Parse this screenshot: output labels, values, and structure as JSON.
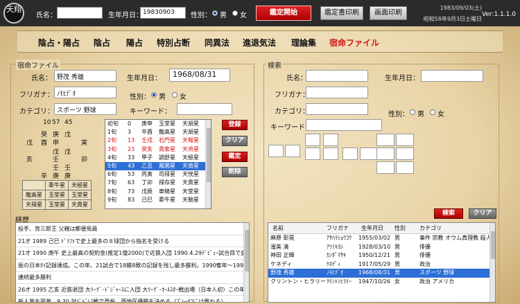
{
  "topbar": {
    "logo_text": "天翔",
    "name_label": "氏名：",
    "name_value": "",
    "birth_label": "生年月日：",
    "birth_value": "19830903",
    "sex_label": "性別：",
    "sex_male": "男",
    "sex_female": "女",
    "btn_appraise": "鑑定開始",
    "btn_print_report": "鑑定書印刷",
    "btn_print_screen": "画面印刷",
    "date_line1": "1983/09/03(土)",
    "date_line2": "昭和58年9月3日土曜日",
    "version": "Ver:1.1.1.0"
  },
  "menu": {
    "items": [
      "陰占・陽占",
      "陰占",
      "陽占",
      "特別占断",
      "同異法",
      "進退気法",
      "理論集",
      "宿命ファイル"
    ],
    "active_index": 7,
    "active_color": "#d01818"
  },
  "file_panel": {
    "title": "宿命ファイル",
    "name_label": "氏名：",
    "name_value": "野茂 秀雄",
    "furigana_label": "フリガナ：",
    "furigana_value": "ﾉﾓﾋﾃﾞｵ",
    "category_label": "カテゴリ：",
    "category_value": "スポーツ 野球",
    "birth_label": "生年月日：",
    "birth_value": "1968/08/31",
    "sex_label": "性別：",
    "sex_male": "男",
    "sex_female": "女",
    "keyword_label": "キーワード：",
    "keyword_value": ""
  },
  "pillars": {
    "nums": [
      "10",
      "57",
      "45"
    ],
    "stems": [
      "癸",
      "庚",
      "戊"
    ],
    "branches": [
      "戊",
      "酉",
      "申",
      "寅"
    ],
    "hidden": [
      "戊",
      "戊"
    ],
    "extra": [
      "亥",
      "壬",
      "卯"
    ],
    "row4": [
      "壬",
      "壬"
    ],
    "row5": [
      "辛",
      "庚",
      "庚"
    ]
  },
  "star_table": [
    [
      "",
      "牽牛星",
      "天極星"
    ],
    [
      "龍高星",
      "玉堂星",
      "玉堂星"
    ],
    [
      "天禄星",
      "玉堂星",
      "天貴星"
    ]
  ],
  "luck_list": [
    {
      "period": "初旬",
      "age": "0",
      "kan": "庚申",
      "star": "玉堂星",
      "star2": "天胡星",
      "red": false,
      "selected": false
    },
    {
      "period": "1旬",
      "age": "3",
      "kan": "辛酉",
      "star": "龍高星",
      "star2": "天胡星",
      "red": false,
      "selected": false
    },
    {
      "period": "2旬",
      "age": "13",
      "kan": "壬戌",
      "star": "石門星",
      "star2": "天報星",
      "red": true,
      "selected": false
    },
    {
      "period": "3旬",
      "age": "23",
      "kan": "癸亥",
      "star": "貴索星",
      "star2": "天将星",
      "red": true,
      "selected": false
    },
    {
      "period": "4旬",
      "age": "33",
      "kan": "甲子",
      "star": "調舒星",
      "star2": "天極星",
      "red": false,
      "selected": false
    },
    {
      "period": "5旬",
      "age": "43",
      "kan": "乙丑",
      "star": "鳳閣星",
      "star2": "天南星",
      "red": false,
      "selected": true
    },
    {
      "period": "6旬",
      "age": "53",
      "kan": "丙寅",
      "star": "司禄星",
      "star2": "天恍星",
      "red": false,
      "selected": false
    },
    {
      "period": "7旬",
      "age": "63",
      "kan": "丁卯",
      "star": "禄存星",
      "star2": "天貴星",
      "red": false,
      "selected": false
    },
    {
      "period": "8旬",
      "age": "73",
      "kan": "戊辰",
      "star": "車騎星",
      "star2": "天堂星",
      "red": false,
      "selected": false
    },
    {
      "period": "9旬",
      "age": "83",
      "kan": "己巳",
      "star": "牽牛星",
      "star2": "天馳星",
      "red": false,
      "selected": false
    }
  ],
  "side_buttons": {
    "register": "登録",
    "clear": "クリア",
    "appraise": "鑑定",
    "delete": "削除"
  },
  "memo": {
    "title": "経歴",
    "lines": [
      "投手、背三郎王 父親は郵便局員",
      "21才 1989 己巳 ﾄﾞﾗﾌﾄで史上最多の８球団から指名を受ける",
      "21才 1990 庚午 史上最高の契約金(推定1億2000)で近鉄入団 1990.4.29ﾃﾞﾋﾞｭｰ試合目で史上2人目の17奪三",
      "振の日本ﾀｲ記録達成。この年、21試合で18勝8敗の記録を残し最多勝利。1990奪年〜1993奪貢まで4年",
      "連続最多勝利",
      "26才 1995 乙亥 近鉄退団 大ﾘｰｸﾞ･ﾄﾞｼﾞｬｰｽに入団 大ﾘｰｸﾞ･ｵｰﾙｽﾀｰ戦出場（日本人初）この年１３勝６敗で",
      "新人賞を受賞。9.30 対ﾊﾟﾄﾞﾚｽ戦で登板、西地区優勝を決める（ﾌﾟﾚｰｵﾌには敗れる）"
    ]
  },
  "search_panel": {
    "title": "検索",
    "name_label": "氏名：",
    "birth_label": "生年月日：",
    "furigana_label": "フリガナ：",
    "category_label": "カテゴリ：",
    "sex_label": "性別：",
    "sex_male": "男",
    "sex_female": "女",
    "keyword_label": "キーワード：",
    "btn_search": "検索",
    "btn_clear": "クリア"
  },
  "results": {
    "headers": [
      "名前",
      "フリガナ",
      "生年月日",
      "性別",
      "カテゴリ"
    ],
    "rows": [
      {
        "name": "麻原 彰晃",
        "kana": "ｱｻﾊﾗｼｮｳｺｳ",
        "birth": "1955/03/02",
        "sex": "男",
        "cat": "事件 宗教 オウム真理教 殺人",
        "selected": false
      },
      {
        "name": "渥美 清",
        "kana": "ｱﾂﾐｷﾖｼ",
        "birth": "1928/03/10",
        "sex": "男",
        "cat": "俳優",
        "selected": false
      },
      {
        "name": "神田 正輝",
        "kana": "ｶﾝﾀﾞﾏｻｷ",
        "birth": "1950/12/21",
        "sex": "男",
        "cat": "俳優",
        "selected": false
      },
      {
        "name": "ケネディ",
        "kana": "ｹﾈﾃﾞｨ",
        "birth": "1917/05/29",
        "sex": "男",
        "cat": "政治",
        "selected": false
      },
      {
        "name": "野茂 秀雄",
        "kana": "ﾉﾓﾋﾃﾞｵ",
        "birth": "1968/08/31",
        "sex": "男",
        "cat": "スポーツ 野球",
        "selected": true
      },
      {
        "name": "クリントン・ヒラリー",
        "kana": "ｸﾘﾝﾄﾝﾋﾗﾘｰ",
        "birth": "1947/10/26",
        "sex": "女",
        "cat": "政治 アメリカ",
        "selected": false
      }
    ]
  }
}
